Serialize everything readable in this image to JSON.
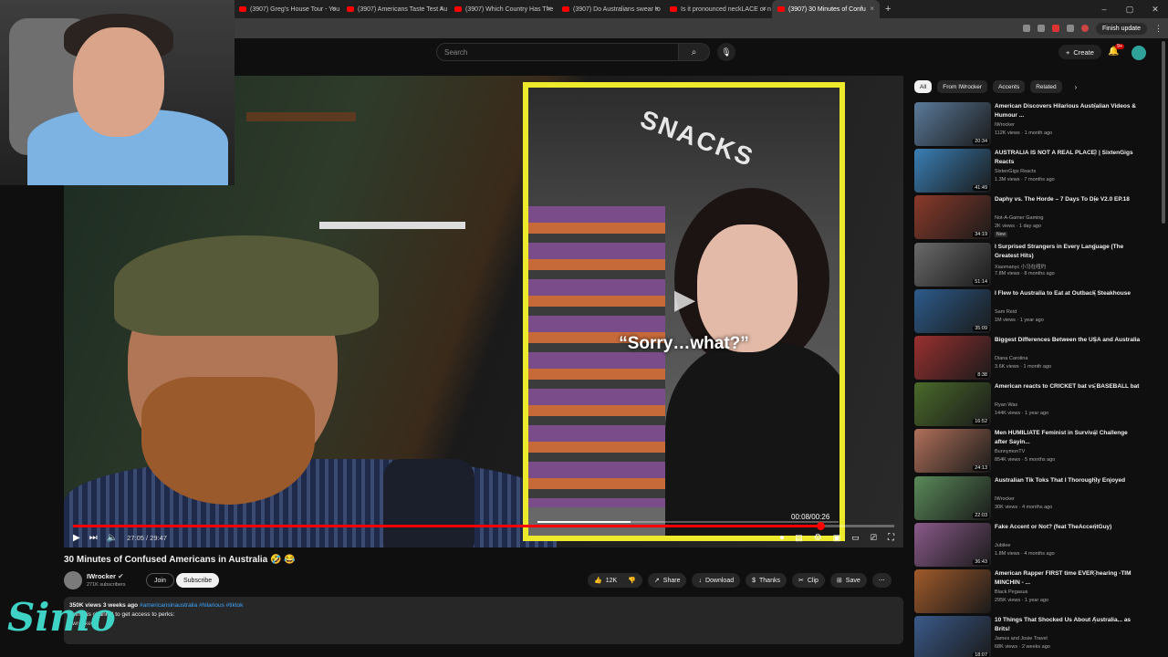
{
  "browser": {
    "tabs": [
      {
        "label": "(3907) Greg's House Tour - You",
        "active": false
      },
      {
        "label": "(3907) Americans Taste Test Au",
        "active": false
      },
      {
        "label": "(3907) Which Country Has The",
        "active": false
      },
      {
        "label": "(3907) Do Australians swear to",
        "active": false
      },
      {
        "label": "Is it pronounced neckLACE or n",
        "active": false
      },
      {
        "label": "(3907) 30 Minutes of Confu",
        "active": true
      }
    ],
    "finish_update": "Finish update"
  },
  "masthead": {
    "search_placeholder": "Search",
    "create": "Create",
    "notif_count": "9+"
  },
  "player": {
    "caption": "“Sorry…what?”",
    "inner_time": "00:08/00:26",
    "time": "27:05 / 29:47",
    "progress": 0.91,
    "inner_progress": 0.31
  },
  "video": {
    "title": "30 Minutes of Confused Americans in Australia 🤣 😂",
    "channel": "IWrocker",
    "subscribers": "271K subscribers",
    "join": "Join",
    "subscribe": "Subscribe",
    "likes": "12K",
    "share": "Share",
    "download": "Download",
    "thanks": "Thanks",
    "clip": "Clip",
    "save": "Save",
    "stats": "350K views  3 weeks ago",
    "tags": "#americansinaustralia #hilarious #tiktok",
    "desc_line1": "Join this channel to get access to perks:",
    "desc_line2": "/iwrocker"
  },
  "watermark": "Simo",
  "chips": [
    "All",
    "From IWrocker",
    "Accents",
    "Related"
  ],
  "recommendations": [
    {
      "title": "American Discovers Hilarious Australian Videos & Humour ...",
      "channel": "IWrocker",
      "meta": "112K views · 1 month ago",
      "duration": "20:34",
      "color": "#5a7a9a"
    },
    {
      "title": "AUSTRALIA IS NOT A REAL PLACE! | SixtenGigs Reacts",
      "channel": "SixtenGigs Reacts",
      "meta": "1.3M views · 7 months ago",
      "duration": "41:49",
      "color": "#3a7fb5"
    },
    {
      "title": "Daphy vs. The Horde – 7 Days To Die V2.0 EP.18",
      "channel": "Not-A-Gamer Gaming",
      "meta": "2K views · 1 day ago",
      "duration": "34:19",
      "color": "#8a3a2a",
      "badge": "New"
    },
    {
      "title": "I Surprised Strangers in Every Language (The Greatest Hits)",
      "channel": "Xiaomanyc 小马在纽约",
      "meta": "7.8M views · 8 months ago",
      "duration": "51:14",
      "color": "#6a6a6a"
    },
    {
      "title": "I Flew to Australia to Eat at Outback Steakhouse",
      "channel": "Sam Reid",
      "meta": "1M views · 1 year ago",
      "duration": "35:09",
      "color": "#2c5b8a"
    },
    {
      "title": "Biggest Differences Between the USA and Australia",
      "channel": "Diana Carolina",
      "meta": "3.6K views · 1 month ago",
      "duration": "8:38",
      "color": "#9a3030"
    },
    {
      "title": "American reacts to CRICKET bat vs BASEBALL bat",
      "channel": "Ryan Was",
      "meta": "144K views · 1 year ago",
      "duration": "16:52",
      "color": "#4a6a2a"
    },
    {
      "title": "Men HUMILIATE Feminist in Survival Challenge after Sayin...",
      "channel": "BunnymonTV",
      "meta": "854K views · 5 months ago",
      "duration": "24:13",
      "color": "#b0705a"
    },
    {
      "title": "Australian Tik Toks That I Thoroughly Enjoyed",
      "channel": "IWrocker",
      "meta": "30K views · 4 months ago",
      "duration": "22:03",
      "color": "#5a8a5a"
    },
    {
      "title": "Fake Accent or Not? (feat TheAccentGuy)",
      "channel": "Jubilee",
      "meta": "1.8M views · 4 months ago",
      "duration": "36:43",
      "color": "#8a5a8a"
    },
    {
      "title": "American Rapper FIRST time EVER hearing -TIM MINCHIN - ...",
      "channel": "Black Pegasus",
      "meta": "295K views · 1 year ago",
      "duration": "",
      "color": "#a05a2a"
    },
    {
      "title": "10 Things That Shocked Us About Australia... as Brits!",
      "channel": "James and Josie Travel",
      "meta": "68K views · 2 weeks ago",
      "duration": "18:07",
      "color": "#3a5a8a"
    }
  ]
}
